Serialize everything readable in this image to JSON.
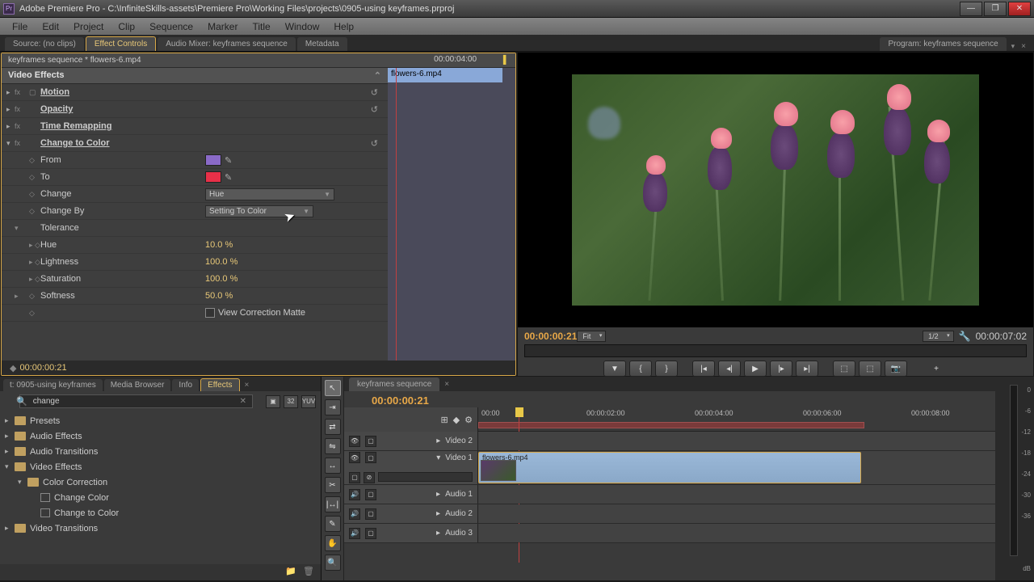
{
  "title": "Adobe Premiere Pro - C:\\InfiniteSkills-assets\\Premiere Pro\\Working Files\\projects\\0905-using keyframes.prproj",
  "menu": [
    "File",
    "Edit",
    "Project",
    "Clip",
    "Sequence",
    "Marker",
    "Title",
    "Window",
    "Help"
  ],
  "srcTabs": {
    "items": [
      "Source: (no clips)",
      "Effect Controls",
      "Audio Mixer: keyframes sequence",
      "Metadata"
    ],
    "active": 1
  },
  "effectControls": {
    "breadcrumb": "keyframes sequence * flowers-6.mp4",
    "rulerTime": "00:00:04:00",
    "clipLabel": "flowers-6.mp4",
    "sectionTitle": "Video Effects",
    "motion": "Motion",
    "opacity": "Opacity",
    "timeRemap": "Time Remapping",
    "changeToColor": "Change to Color",
    "fromLabel": "From",
    "fromColor": "#8a6ac8",
    "toLabel": "To",
    "toColor": "#e83048",
    "changeLabel": "Change",
    "changeValue": "Hue",
    "changeByLabel": "Change By",
    "changeByValue": "Setting To Color",
    "toleranceLabel": "Tolerance",
    "hueLabel": "Hue",
    "hueValue": "10.0 %",
    "lightnessLabel": "Lightness",
    "lightnessValue": "100.0 %",
    "saturationLabel": "Saturation",
    "saturationValue": "100.0 %",
    "softnessLabel": "Softness",
    "softnessValue": "50.0 %",
    "viewMatteLabel": "View Correction Matte",
    "footerTime": "00:00:00:21"
  },
  "program": {
    "tabLabel": "Program: keyframes sequence",
    "tcLeft": "00:00:00:21",
    "tcRight": "00:00:07:02",
    "fitLabel": "Fit",
    "zoomLabel": "1/2"
  },
  "effectsBrowser": {
    "tabs": [
      "t: 0905-using keyframes",
      "Media Browser",
      "Info",
      "Effects"
    ],
    "activeTab": 3,
    "search": "change",
    "tree": {
      "presets": "Presets",
      "audioFx": "Audio Effects",
      "audioTr": "Audio Transitions",
      "videoFx": "Video Effects",
      "colorCorr": "Color Correction",
      "changeColor": "Change Color",
      "changeToColor": "Change to Color",
      "videoTr": "Video Transitions"
    }
  },
  "timeline": {
    "tabLabel": "keyframes sequence",
    "tc": "00:00:00:21",
    "ticks": [
      "00:00",
      "00:00:02:00",
      "00:00:04:00",
      "00:00:06:00",
      "00:00:08:00"
    ],
    "tracks": {
      "video2": "Video 2",
      "video1": "Video 1",
      "audio1": "Audio 1",
      "audio2": "Audio 2",
      "audio3": "Audio 3"
    },
    "clipName": "flowers-6.mp4"
  },
  "meterLabels": [
    "0",
    "-6",
    "-12",
    "-18",
    "-24",
    "-30",
    "-36",
    "dB"
  ]
}
